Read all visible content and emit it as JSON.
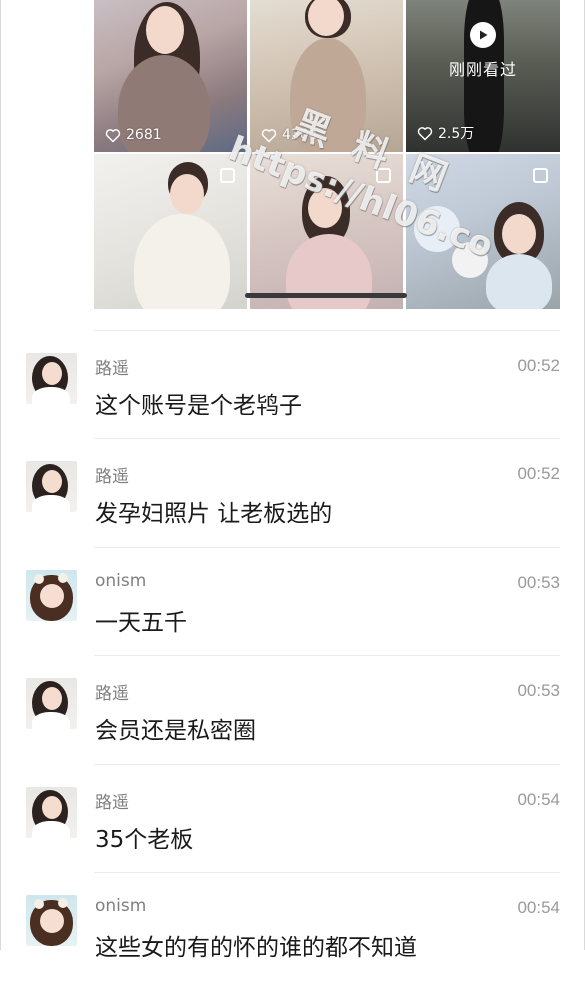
{
  "gallery": {
    "likes": [
      "2681",
      "4304",
      "2.5万"
    ],
    "recently_viewed_label": "刚刚看过"
  },
  "watermark": {
    "title": "黑料网",
    "url": "https://hl06.co"
  },
  "messages": [
    {
      "name": "路遥",
      "time": "00:52",
      "text": "这个账号是个老鸨子",
      "avatar": "photo-avatar"
    },
    {
      "name": "路遥",
      "time": "00:52",
      "text": "发孕妇照片 让老板选的",
      "avatar": "photo-avatar"
    },
    {
      "name": "onism",
      "time": "00:53",
      "text": "一天五千",
      "avatar": "illustrated-avatar"
    },
    {
      "name": "路遥",
      "time": "00:53",
      "text": "会员还是私密圈",
      "avatar": "photo-avatar"
    },
    {
      "name": "路遥",
      "time": "00:54",
      "text": "35个老板",
      "avatar": "photo-avatar"
    },
    {
      "name": "onism",
      "time": "00:54",
      "text": "这些女的有的怀的谁的都不知道",
      "avatar": "illustrated-avatar"
    }
  ]
}
